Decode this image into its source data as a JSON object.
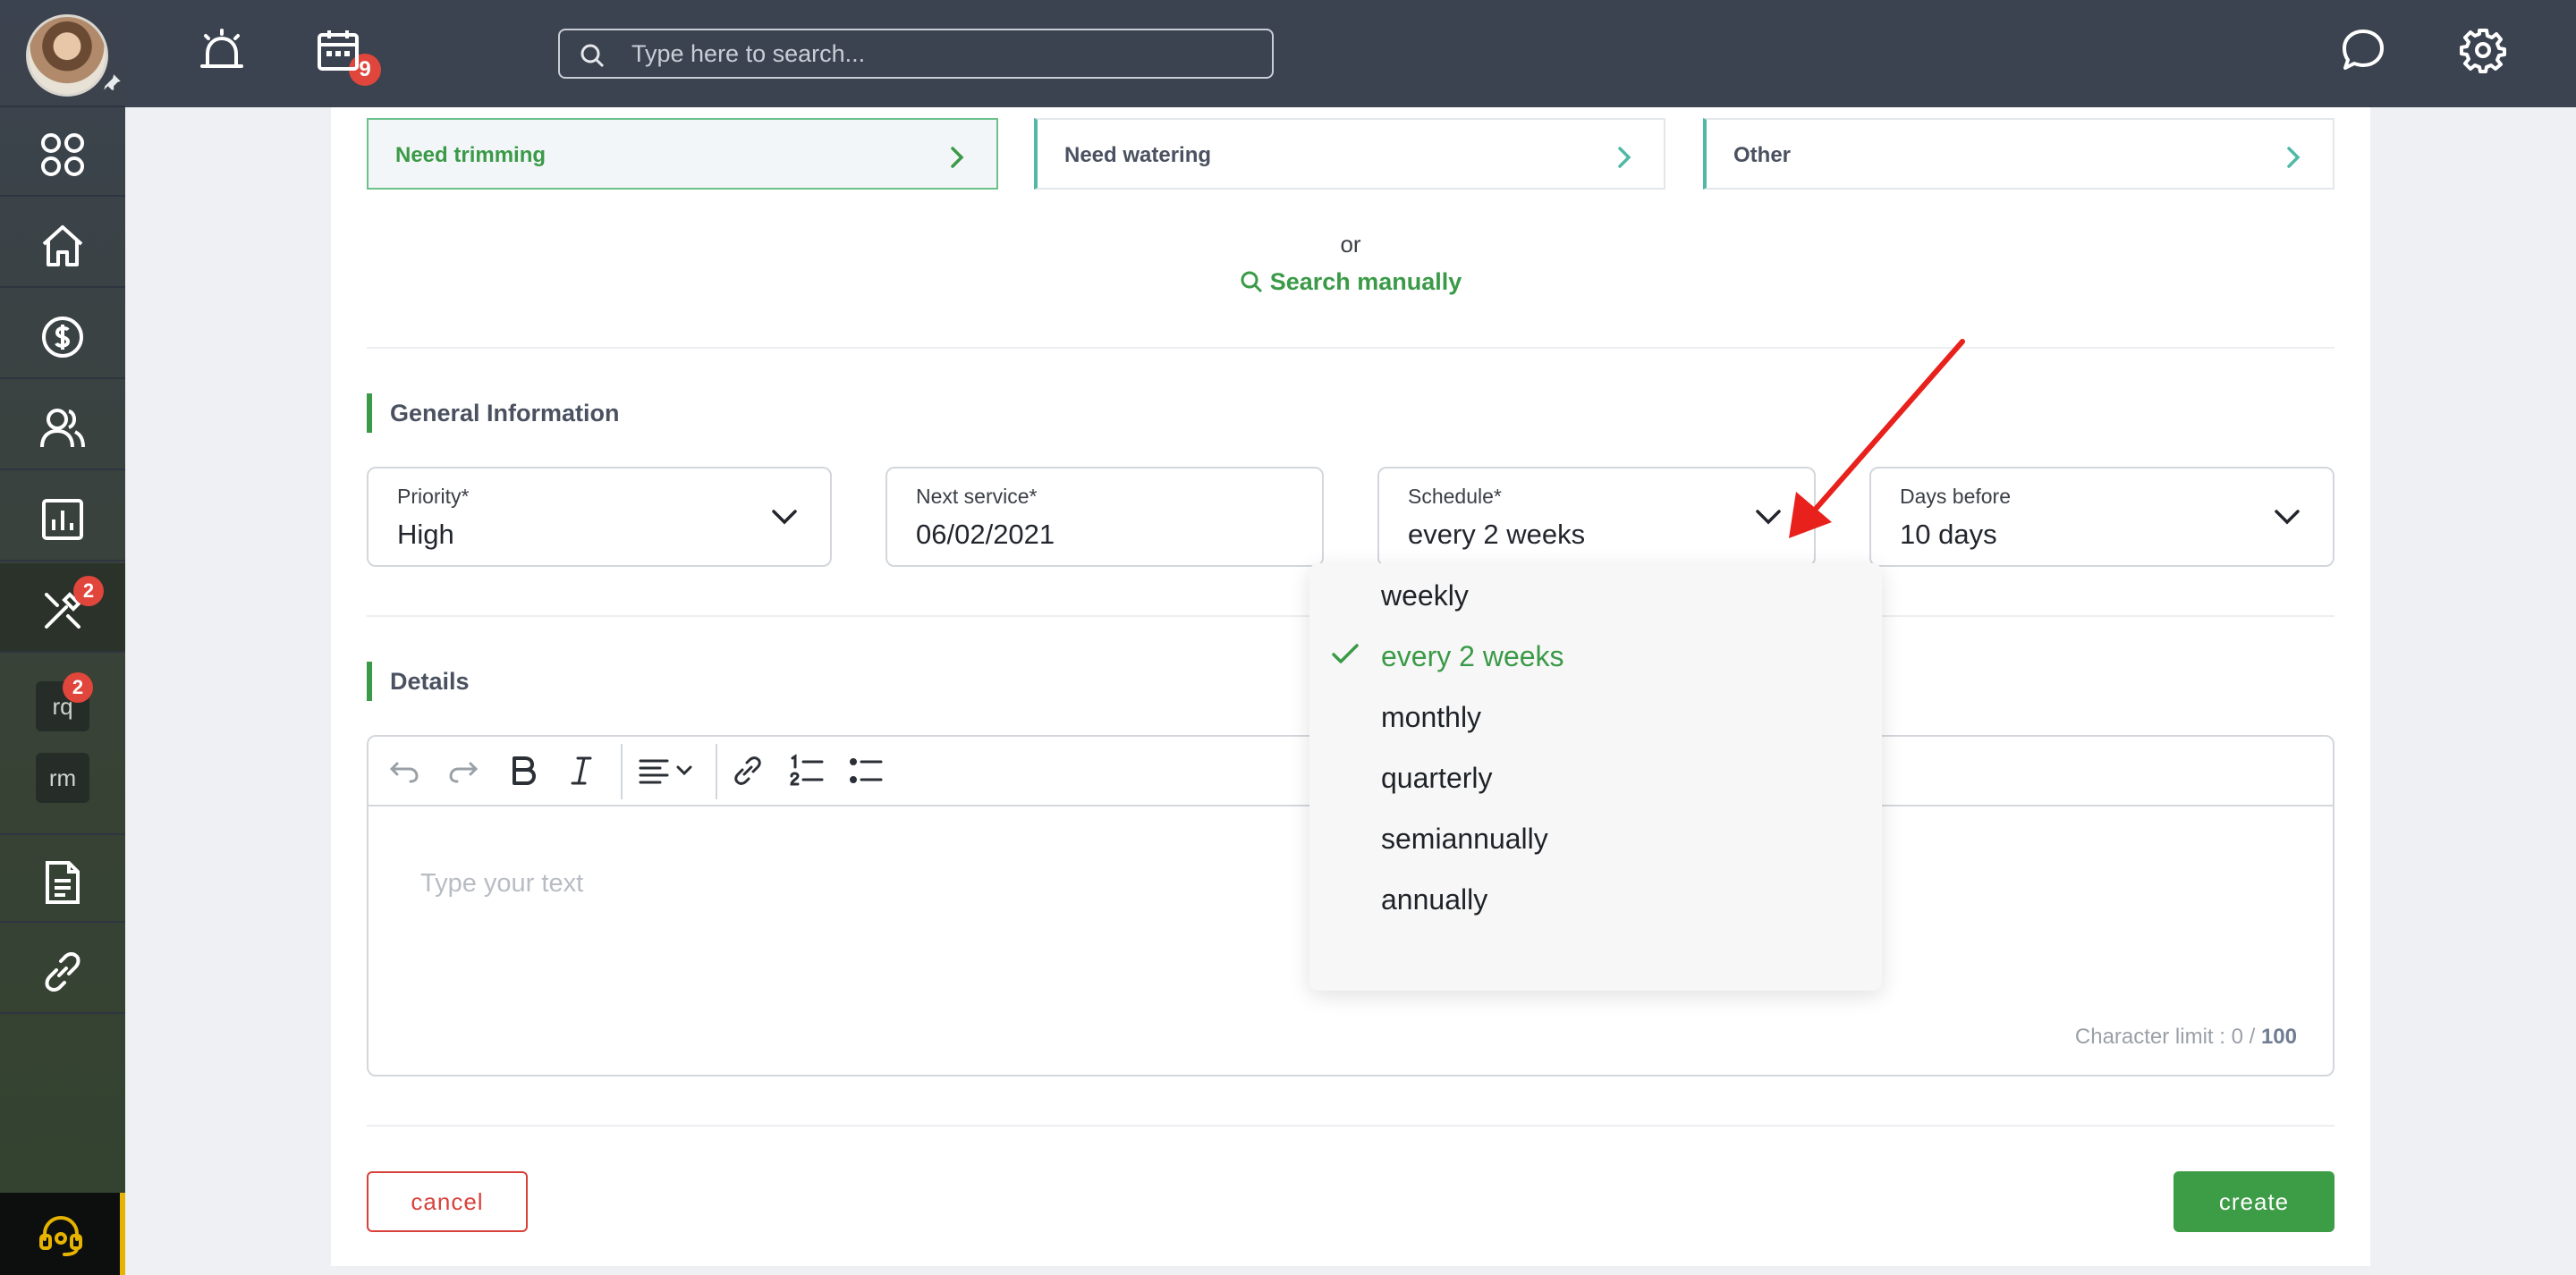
{
  "topbar": {
    "notification_count": "9",
    "search_placeholder": "Type here to search..."
  },
  "sidebar": {
    "tools_badge": "2",
    "rq_badge": "2",
    "chip_rq": "rq",
    "chip_rm": "rm"
  },
  "categories": [
    {
      "label": "Need trimming",
      "active": true
    },
    {
      "label": "Need watering",
      "active": false
    },
    {
      "label": "Other",
      "active": false
    }
  ],
  "search_alt": {
    "or_text": "or",
    "manual_label": "Search manually"
  },
  "general": {
    "title": "General Information",
    "priority": {
      "label": "Priority*",
      "value": "High"
    },
    "next_service": {
      "label": "Next service*",
      "value": "06/02/2021"
    },
    "schedule": {
      "label": "Schedule*",
      "value": "every 2 weeks"
    },
    "days_before": {
      "label": "Days before",
      "value": "10 days"
    }
  },
  "schedule_options": [
    {
      "label": "weekly",
      "selected": false
    },
    {
      "label": "every 2 weeks",
      "selected": true
    },
    {
      "label": "monthly",
      "selected": false
    },
    {
      "label": "quarterly",
      "selected": false
    },
    {
      "label": "semiannually",
      "selected": false
    },
    {
      "label": "annually",
      "selected": false
    }
  ],
  "details": {
    "title": "Details",
    "placeholder": "Type your text",
    "char_limit_label": "Character limit : 0 /",
    "char_limit_max": "100"
  },
  "actions": {
    "cancel_label": "cancel",
    "create_label": "create"
  },
  "colors": {
    "accent_green": "#3a9a47",
    "danger_red": "#d8413a",
    "topbar": "#3c4350",
    "badge_red": "#e0463c"
  }
}
